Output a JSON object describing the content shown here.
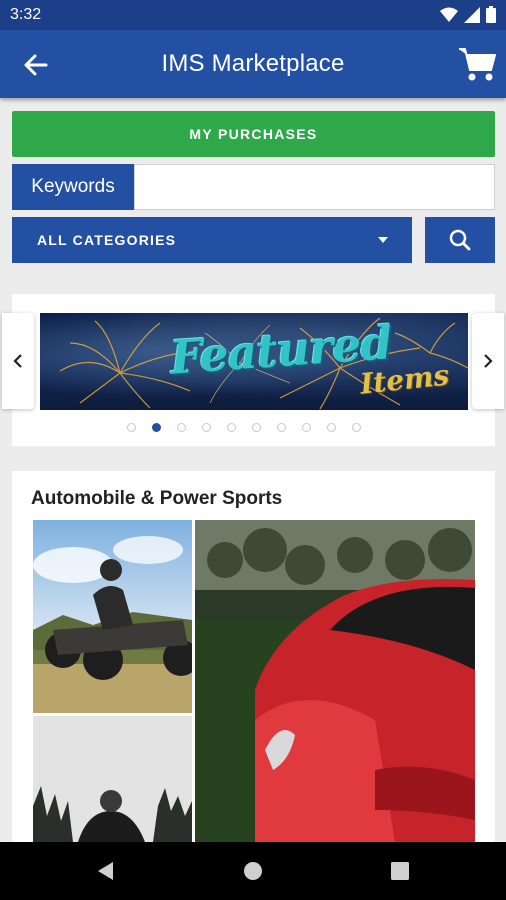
{
  "status_bar": {
    "time": "3:32",
    "icons": [
      "wifi-icon",
      "signal-icon",
      "battery-icon"
    ]
  },
  "app_bar": {
    "title": "IMS Marketplace",
    "back_icon": "arrow-left-icon",
    "cart_icon": "cart-icon"
  },
  "buttons": {
    "my_purchases": "MY PURCHASES"
  },
  "search": {
    "keywords_label": "Keywords",
    "keywords_value": "",
    "category_selected": "ALL CATEGORIES",
    "search_icon": "search-icon"
  },
  "carousel": {
    "banner_text_main": "Featured",
    "banner_text_sub": "Items",
    "dot_count": 10,
    "active_index": 1,
    "prev_icon": "chevron-left-icon",
    "next_icon": "chevron-right-icon"
  },
  "section": {
    "title": "Automobile & Power Sports"
  },
  "colors": {
    "primary": "#2450a4",
    "status_bar": "#1d3f8a",
    "success": "#2fa84a",
    "background": "#ececec"
  },
  "nav_bar": {
    "icons": [
      "back-triangle-icon",
      "home-circle-icon",
      "recents-square-icon"
    ]
  }
}
